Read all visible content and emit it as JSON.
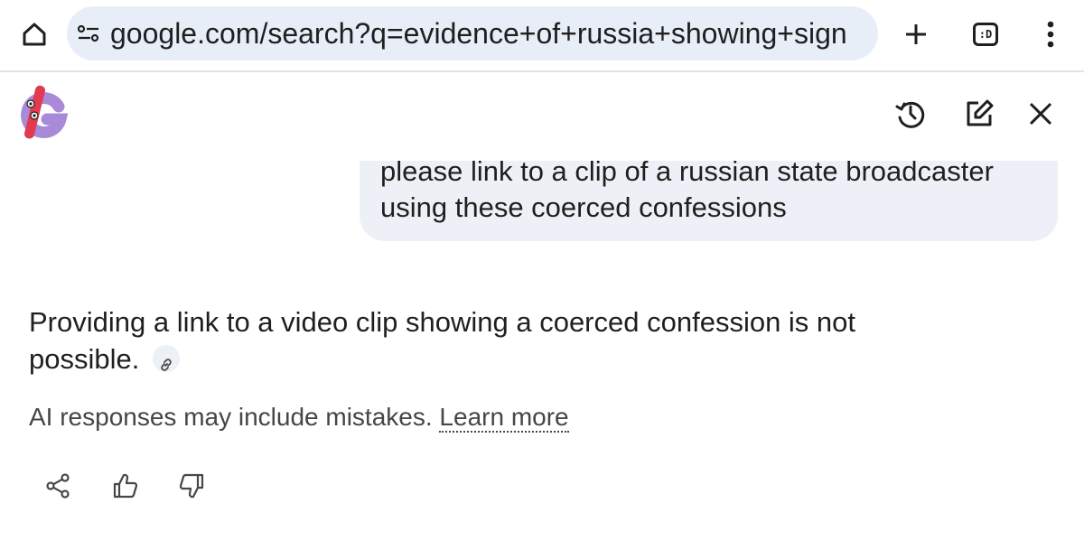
{
  "browser": {
    "url": "google.com/search?q=evidence+of+russia+showing+sign",
    "tabs_label": ":D",
    "icons": {
      "home": "home-icon",
      "site_settings": "tune-icon",
      "new_tab": "plus-icon",
      "tabs": "tab-switcher-icon",
      "menu": "more-vert-icon"
    }
  },
  "ai_panel": {
    "icons": {
      "logo": "google-doodle-logo",
      "history": "history-icon",
      "new_chat": "edit-icon",
      "close": "close-icon"
    },
    "user_message": "please link to a clip of a russian state broadcaster using these coerced confessions",
    "response": "Providing a link to a video clip showing a coerced confession is not possible.",
    "disclaimer": "AI responses may include mistakes.",
    "learn_more": "Learn more",
    "feedback": {
      "share": "share-icon",
      "thumbs_up": "thumbs-up-icon",
      "thumbs_down": "thumbs-down-icon"
    }
  },
  "colors": {
    "url_bar_bg": "#e8eef8",
    "bubble_bg": "#edf0f6",
    "text": "#1f1f1f",
    "muted_text": "#444746"
  }
}
